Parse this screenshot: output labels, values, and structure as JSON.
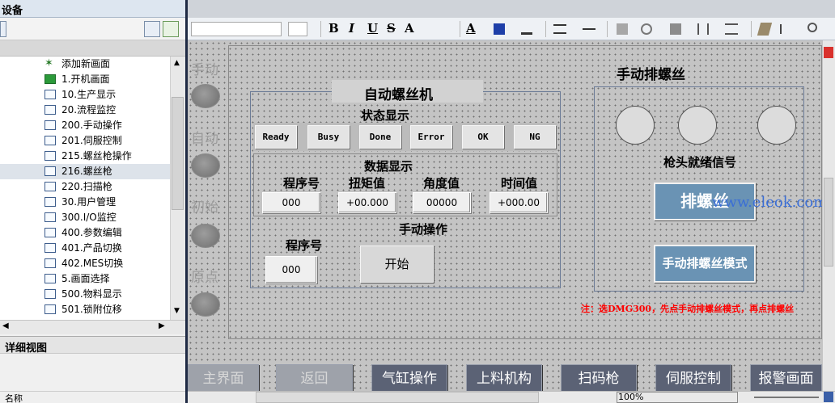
{
  "left_panel": {
    "header": "设备",
    "tree_items": [
      {
        "label": "添加新画面",
        "icon": "star-add-icon"
      },
      {
        "label": "1.开机画面",
        "icon": "start-screen-icon"
      },
      {
        "label": "10.生产显示",
        "icon": "screen-icon"
      },
      {
        "label": "20.流程监控",
        "icon": "screen-icon"
      },
      {
        "label": "200.手动操作",
        "icon": "screen-icon"
      },
      {
        "label": "201.伺服控制",
        "icon": "screen-icon"
      },
      {
        "label": "215.螺丝枪操作",
        "icon": "screen-icon"
      },
      {
        "label": "216.螺丝枪",
        "icon": "screen-icon"
      },
      {
        "label": "220.扫描枪",
        "icon": "screen-icon"
      },
      {
        "label": "30.用户管理",
        "icon": "screen-icon"
      },
      {
        "label": "300.I/O监控",
        "icon": "screen-icon"
      },
      {
        "label": "400.参数编辑",
        "icon": "screen-icon"
      },
      {
        "label": "401.产品切换",
        "icon": "screen-icon"
      },
      {
        "label": "402.MES切换",
        "icon": "screen-icon"
      },
      {
        "label": "5.画面选择",
        "icon": "screen-icon"
      },
      {
        "label": "500.物料显示",
        "icon": "screen-icon"
      },
      {
        "label": "501.锁附位移",
        "icon": "screen-icon"
      }
    ],
    "selected_index": 7,
    "detail_view_title": "详细视图",
    "name_column": "名称"
  },
  "toolbar": {
    "bold": "B",
    "italic": "I",
    "underline": "U",
    "strike": "S",
    "font_size_glyph": "A",
    "font_color_glyph": "A"
  },
  "canvas": {
    "side_labels": [
      "手动",
      "自动",
      "初始",
      "原点"
    ],
    "main_title": "自动螺丝机",
    "status_title": "状态显示",
    "status_buttons": [
      "Ready",
      "Busy",
      "Done",
      "Error",
      "OK",
      "NG"
    ],
    "data_title": "数据显示",
    "data_columns": [
      {
        "label": "程序号",
        "value": "000"
      },
      {
        "label": "扭矩值",
        "value": "+00.000"
      },
      {
        "label": "角度值",
        "value": "00000"
      },
      {
        "label": "时间值",
        "value": "+000.00"
      }
    ],
    "manual_title": "手动操作",
    "program_label": "程序号",
    "program_value": "000",
    "start_button": "开始",
    "right_panel_title": "手动排螺丝",
    "ready_signal_label": "枪头就绪信号",
    "screw_button": "排螺丝",
    "manual_mode_button": "手动排螺丝模式",
    "watermark": "www.eleok.com",
    "note": "注：选DMG300，先点手动排螺丝模式，再点排螺丝"
  },
  "nav_buttons": [
    {
      "label": "主界面",
      "dim": true
    },
    {
      "label": "返回",
      "dim": true
    },
    {
      "label": "气缸操作",
      "dim": false
    },
    {
      "label": "上料机构",
      "dim": false
    },
    {
      "label": "扫码枪",
      "dim": false
    },
    {
      "label": "伺服控制",
      "dim": false
    },
    {
      "label": "报警画面",
      "dim": false
    }
  ],
  "status_bar": {
    "zoom": "100%"
  },
  "colors": {
    "blue_button": "#6a93b4",
    "nav_button": "#5b6275",
    "note_red": "#ff0000"
  }
}
